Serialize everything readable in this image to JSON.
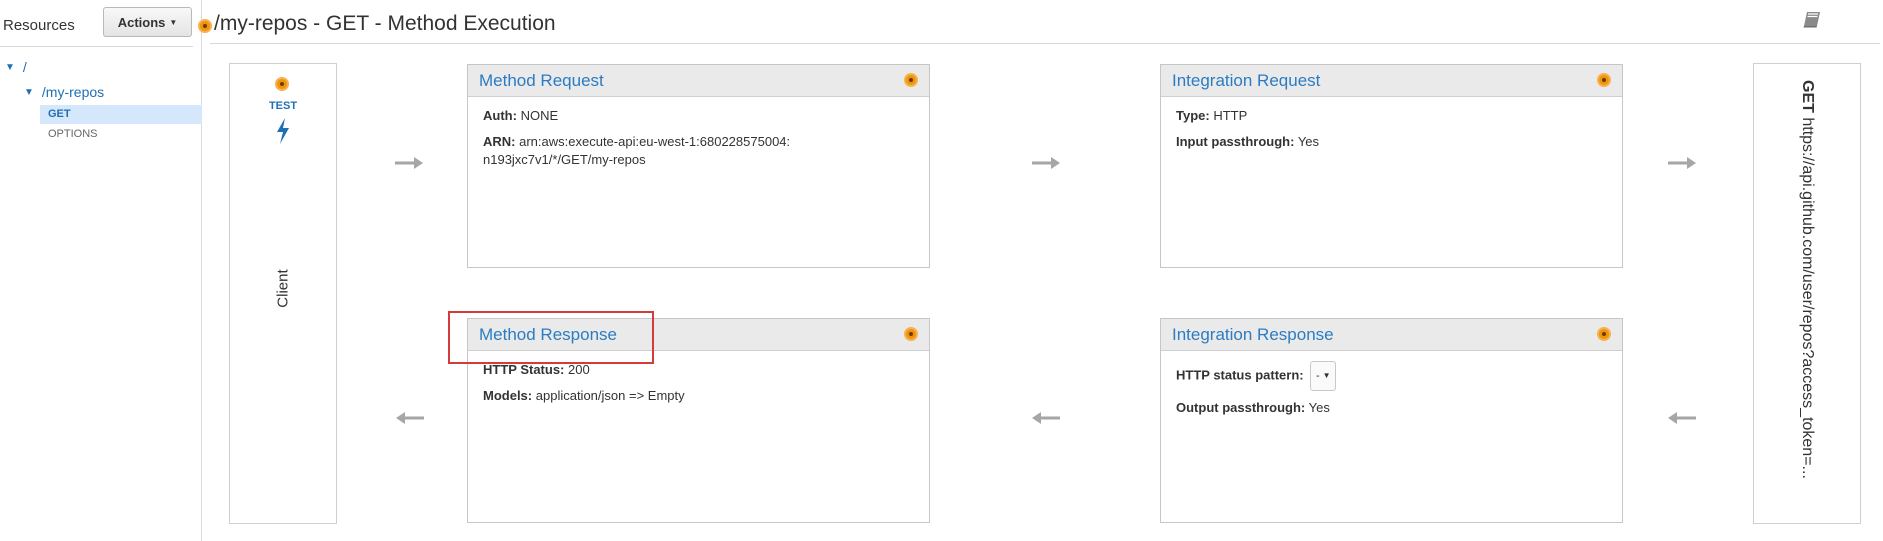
{
  "sidebar": {
    "title": "Resources",
    "actions_label": "Actions",
    "tree": {
      "root": "/",
      "resource": "/my-repos",
      "methods": [
        "GET",
        "OPTIONS"
      ]
    }
  },
  "header": {
    "title": "/my-repos - GET - Method Execution"
  },
  "client": {
    "test_label": "TEST",
    "label": "Client"
  },
  "method_request": {
    "title": "Method Request",
    "auth_label": "Auth:",
    "auth_value": "NONE",
    "arn_label": "ARN:",
    "arn_value": "arn:aws:execute-api:eu-west-1:680228575004:n193jxc7v1/*/GET/my-repos"
  },
  "integration_request": {
    "title": "Integration Request",
    "type_label": "Type:",
    "type_value": "HTTP",
    "passthrough_label": "Input passthrough:",
    "passthrough_value": "Yes"
  },
  "method_response": {
    "title": "Method Response",
    "status_label": "HTTP Status:",
    "status_value": "200",
    "models_label": "Models:",
    "models_value": "application/json => Empty"
  },
  "integration_response": {
    "title": "Integration Response",
    "pattern_label": "HTTP status pattern:",
    "pattern_value": "-",
    "passthrough_label": "Output passthrough:",
    "passthrough_value": "Yes"
  },
  "endpoint": {
    "method": "GET",
    "url": "https://api.github.com/user/repos?access_token=..."
  },
  "colors": {
    "accent": "#2b7cc3",
    "status_dot": "#f0940f",
    "highlight_border": "#d43c3c",
    "selected_row": "#d5e8fb"
  },
  "icons": [
    "status-dot-icon",
    "book-icon",
    "lightning-bolt-icon",
    "arrow-right-icon",
    "arrow-left-icon",
    "caret-down-icon"
  ]
}
